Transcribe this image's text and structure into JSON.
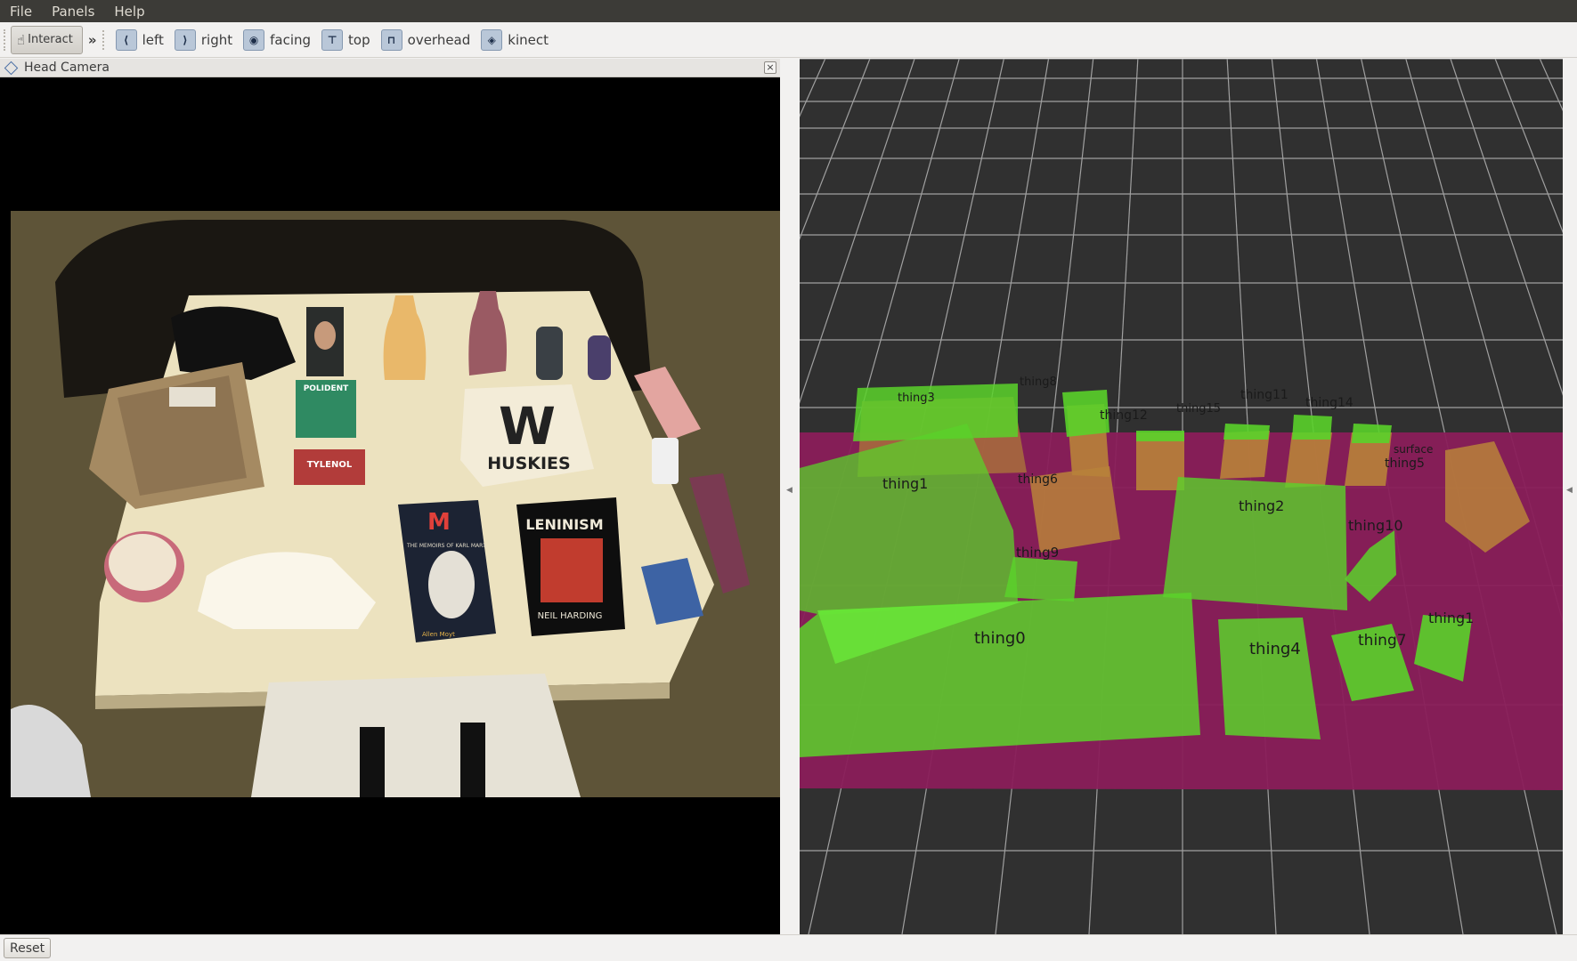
{
  "menu": {
    "file": "File",
    "panels": "Panels",
    "help": "Help"
  },
  "toolbar": {
    "interact": "Interact",
    "more": "»",
    "views": [
      {
        "label": "left",
        "icon": "left-view-icon"
      },
      {
        "label": "right",
        "icon": "right-view-icon"
      },
      {
        "label": "facing",
        "icon": "facing-view-icon"
      },
      {
        "label": "top",
        "icon": "top-view-icon"
      },
      {
        "label": "overhead",
        "icon": "overhead-view-icon"
      },
      {
        "label": "kinect",
        "icon": "kinect-view-icon"
      }
    ]
  },
  "camera_panel": {
    "title": "Head Camera",
    "close": "×",
    "scene": {
      "sign_letter": "W",
      "sign_text": "HUSKIES",
      "book1_title": "M",
      "book1_sub": "THE MEMOIRS OF KARL MARX",
      "book1_author": "Allen Moyt",
      "book2_title": "LENINISM",
      "book2_author": "NEIL HARDING",
      "box_label": "POLIDENT",
      "small_box": "TYLENOL"
    }
  },
  "scene3d": {
    "labels": {
      "thing0": "thing0",
      "thing1": "thing1",
      "thing2": "thing2",
      "thing3": "thing3",
      "thing4": "thing4",
      "thing5": "thing5",
      "thing6": "thing6",
      "thing7": "thing7",
      "thing8": "thing8",
      "thing9": "thing9",
      "thing10": "thing10",
      "thing11": "thing11",
      "thing12": "thing12",
      "thing13": "thing1",
      "thing14": "thing14",
      "thing15": "thing15",
      "surface": "surface"
    },
    "colors": {
      "background": "#303030",
      "grid": "#a0a0a0",
      "surface": "#8a1e5a",
      "object": "#5ad22a",
      "hidden_box": "#b8823a"
    }
  },
  "status": {
    "reset": "Reset"
  }
}
